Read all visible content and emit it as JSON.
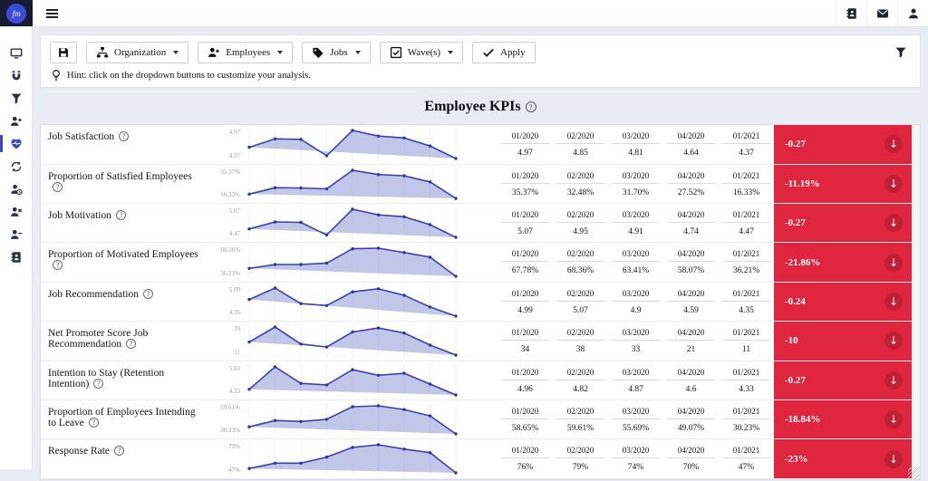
{
  "navbar": {
    "logo_text": "fm",
    "right_icons": [
      "address-book",
      "envelope",
      "user"
    ]
  },
  "sidebar": {
    "items": [
      "monitor",
      "magnet",
      "filter",
      "user-plus",
      "heart-pulse",
      "sync",
      "user-clock",
      "user-times",
      "user-minus",
      "address-book"
    ],
    "active": "heart-pulse"
  },
  "toolbar": {
    "dropdowns": [
      {
        "label": "Organization",
        "icon": "sitemap"
      },
      {
        "label": "Employees",
        "icon": "user-plus"
      },
      {
        "label": "Jobs",
        "icon": "tag"
      },
      {
        "label": "Wave(s)",
        "icon": "check-square"
      }
    ],
    "apply_label": "Apply",
    "hint": "Hint: click on the dropdown buttons to customize your analysis."
  },
  "page_title": "Employee KPIs",
  "colors": {
    "accent": "#3b49c4",
    "danger": "#e0263f",
    "danger_dark": "#c01f34",
    "spark_line": "#3a42ab",
    "spark_fill": "rgba(110,120,200,0.42)"
  },
  "table": {
    "columns": [
      "01/2020",
      "02/2020",
      "03/2020",
      "04/2020",
      "01/2021"
    ],
    "rows": [
      {
        "label": "Job Satisfaction",
        "axis_max": "4.97",
        "axis_min": "4.37",
        "min": 4.37,
        "max": 4.97,
        "values": [
          "4.97",
          "4.85",
          "4.81",
          "4.64",
          "4.37"
        ],
        "delta": "-0.27",
        "spark": [
          4.61,
          4.79,
          4.78,
          4.43,
          4.97,
          4.85,
          4.81,
          4.64,
          4.37
        ]
      },
      {
        "label": "Proportion of Satisfied Employees",
        "axis_max": "35.37%",
        "axis_min": "16.33%",
        "min": 16.33,
        "max": 35.37,
        "values": [
          "35.37%",
          "32.48%",
          "31.70%",
          "27.52%",
          "16.33%"
        ],
        "delta": "-11.19%",
        "spark": [
          19.2,
          23.6,
          23.4,
          22.8,
          35.37,
          32.48,
          31.7,
          27.52,
          16.33
        ]
      },
      {
        "label": "Job Motivation",
        "axis_max": "5.07",
        "axis_min": "4.47",
        "min": 4.47,
        "max": 5.07,
        "values": [
          "5.07",
          "4.95",
          "4.91",
          "4.74",
          "4.47"
        ],
        "delta": "-0.27",
        "spark": [
          4.65,
          4.8,
          4.79,
          4.52,
          5.07,
          4.95,
          4.91,
          4.74,
          4.47
        ]
      },
      {
        "label": "Proportion of Motivated Employees",
        "axis_max": "68.36%",
        "axis_min": "36.21%",
        "min": 36.21,
        "max": 68.36,
        "values": [
          "67.78%",
          "68.36%",
          "63.41%",
          "58.07%",
          "36.21%"
        ],
        "delta": "-21.86%",
        "spark": [
          45.2,
          49.7,
          49.7,
          51.3,
          67.78,
          68.36,
          63.41,
          58.07,
          36.21
        ]
      },
      {
        "label": "Job Recommendation",
        "axis_max": "5.09",
        "axis_min": "4.35",
        "min": 4.35,
        "max": 5.09,
        "values": [
          "4.99",
          "5.07",
          "4.9",
          "4.59",
          "4.35"
        ],
        "delta": "-0.24",
        "spark": [
          4.79,
          5.09,
          4.68,
          4.63,
          4.99,
          5.07,
          4.9,
          4.59,
          4.35
        ]
      },
      {
        "label": "Net Promoter Score Job Recommendation",
        "axis_max": "39",
        "axis_min": "11",
        "min": 11,
        "max": 39,
        "values": [
          "34",
          "38",
          "33",
          "21",
          "11"
        ],
        "delta": "-10",
        "spark": [
          24,
          39,
          22,
          19,
          34,
          38,
          33,
          21,
          11
        ]
      },
      {
        "label": "Intention to Stay (Retention Intention)",
        "axis_max": "5.03",
        "axis_min": "4.33",
        "min": 4.33,
        "max": 5.03,
        "values": [
          "4.96",
          "4.82",
          "4.87",
          "4.6",
          "4.33"
        ],
        "delta": "-0.27",
        "spark": [
          4.47,
          5.03,
          4.62,
          4.58,
          4.96,
          4.82,
          4.87,
          4.6,
          4.33
        ]
      },
      {
        "label": "Proportion of Employees Intending to Leave",
        "axis_max": "59.61%",
        "axis_min": "30.23%",
        "min": 30.23,
        "max": 59.61,
        "values": [
          "58.65%",
          "59.61%",
          "55.69%",
          "49.07%",
          "30.23%"
        ],
        "delta": "-18.84%",
        "spark": [
          37.6,
          44.3,
          43.2,
          45.5,
          58.65,
          59.61,
          55.69,
          49.07,
          30.23
        ]
      },
      {
        "label": "Response Rate",
        "axis_max": "79%",
        "axis_min": "47%",
        "min": 47,
        "max": 79,
        "values": [
          "76%",
          "79%",
          "74%",
          "70%",
          "47%"
        ],
        "delta": "-23%",
        "spark": [
          52,
          58,
          58,
          65,
          76,
          79,
          74,
          70,
          47
        ]
      }
    ]
  }
}
